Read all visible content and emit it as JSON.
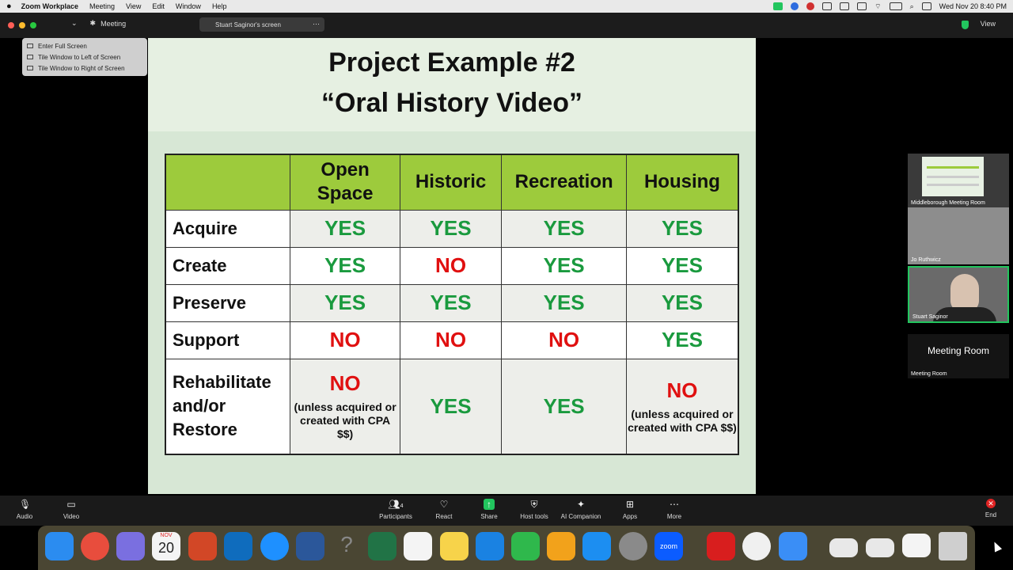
{
  "menubar": {
    "app_name": "Zoom Workplace",
    "menus": [
      "Meeting",
      "View",
      "Edit",
      "Window",
      "Help"
    ],
    "clock": "Wed Nov 20  8:40 PM"
  },
  "topbar": {
    "tab_label": "Meeting",
    "share_pill": "Stuart Saginor's screen",
    "view_label": "View"
  },
  "popup_menu": [
    "Enter Full Screen",
    "Tile Window to Left of Screen",
    "Tile Window to Right of Screen"
  ],
  "slide": {
    "title_line1": "Project Example #2",
    "title_line2": "“Oral History Video”",
    "columns": [
      "Open Space",
      "Historic",
      "Recreation",
      "Housing"
    ],
    "rows": [
      {
        "label": "Acquire",
        "cells": [
          {
            "v": "YES"
          },
          {
            "v": "YES"
          },
          {
            "v": "YES"
          },
          {
            "v": "YES"
          }
        ]
      },
      {
        "label": "Create",
        "cells": [
          {
            "v": "YES"
          },
          {
            "v": "NO"
          },
          {
            "v": "YES"
          },
          {
            "v": "YES"
          }
        ]
      },
      {
        "label": "Preserve",
        "cells": [
          {
            "v": "YES"
          },
          {
            "v": "YES"
          },
          {
            "v": "YES"
          },
          {
            "v": "YES"
          }
        ]
      },
      {
        "label": "Support",
        "cells": [
          {
            "v": "NO"
          },
          {
            "v": "NO"
          },
          {
            "v": "NO"
          },
          {
            "v": "YES"
          }
        ]
      },
      {
        "label": "Rehabilitate and/or Restore",
        "cells": [
          {
            "v": "NO",
            "note": "(unless acquired or created with CPA $$)"
          },
          {
            "v": "YES"
          },
          {
            "v": "YES"
          },
          {
            "v": "NO",
            "note": "(unless acquired or created with CPA $$)"
          }
        ]
      }
    ],
    "colors": {
      "header_bg": "#9dcb3c",
      "yes": "#1a9a3e",
      "no": "#e01010"
    }
  },
  "gallery": {
    "tiles": [
      {
        "name": "Middleborough Meeting Room"
      },
      {
        "name": "Jo Ruthwicz"
      },
      {
        "name": "Stuart Saginor"
      },
      {
        "name": "Meeting Room",
        "big_label": "Meeting Room"
      }
    ]
  },
  "toolbar": {
    "audio": "Audio",
    "video": "Video",
    "participants": "Participants",
    "participants_count": "4",
    "react": "React",
    "share": "Share",
    "host_tools": "Host tools",
    "ai_companion": "AI Companion",
    "apps": "Apps",
    "more": "More",
    "end": "End"
  },
  "dock": {
    "calendar_day": "20",
    "calendar_month": "NOV",
    "zoom_label": "zoom"
  }
}
